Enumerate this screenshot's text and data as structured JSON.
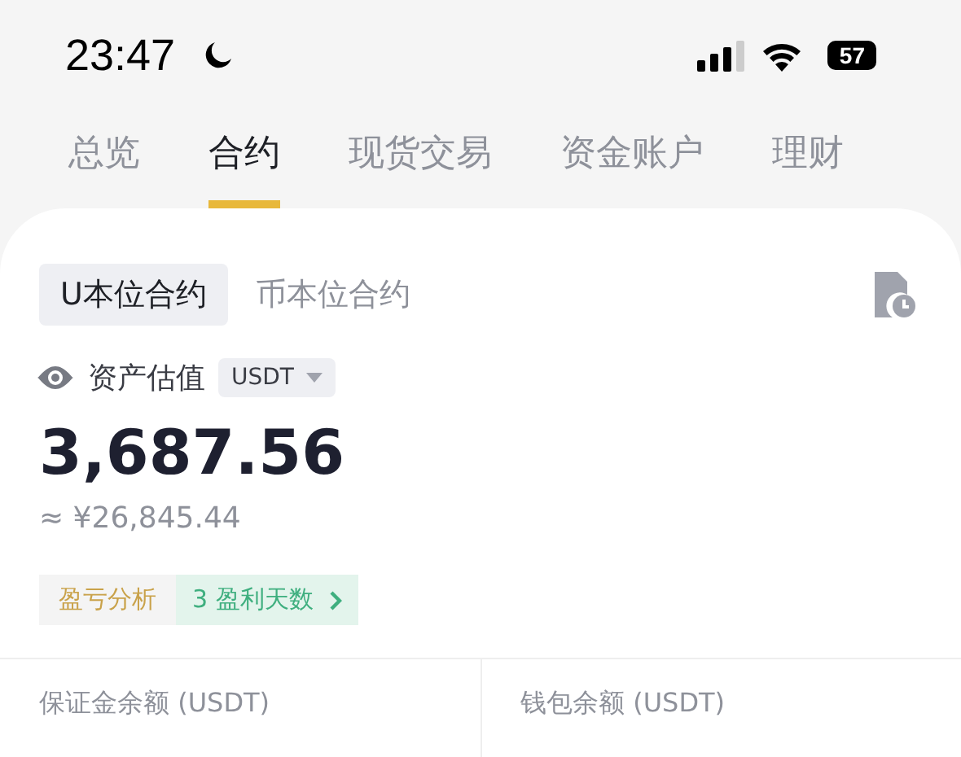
{
  "status_bar": {
    "time": "23:47",
    "battery": "57"
  },
  "tabs": [
    {
      "label": "总览",
      "selected": false
    },
    {
      "label": "合约",
      "selected": true
    },
    {
      "label": "现货交易",
      "selected": false
    },
    {
      "label": "资金账户",
      "selected": false
    },
    {
      "label": "理财",
      "selected": false
    }
  ],
  "contract_types": [
    {
      "label": "U本位合约",
      "selected": true
    },
    {
      "label": "币本位合约",
      "selected": false
    }
  ],
  "valuation": {
    "label": "资产估值",
    "currency": "USDT",
    "amount": "3,687.56",
    "approx": "≈ ¥26,845.44"
  },
  "analysis": {
    "label": "盈亏分析",
    "profit_days": "3 盈利天数"
  },
  "balances": [
    {
      "label": "保证金余额 (USDT)"
    },
    {
      "label": "钱包余额 (USDT)"
    }
  ]
}
